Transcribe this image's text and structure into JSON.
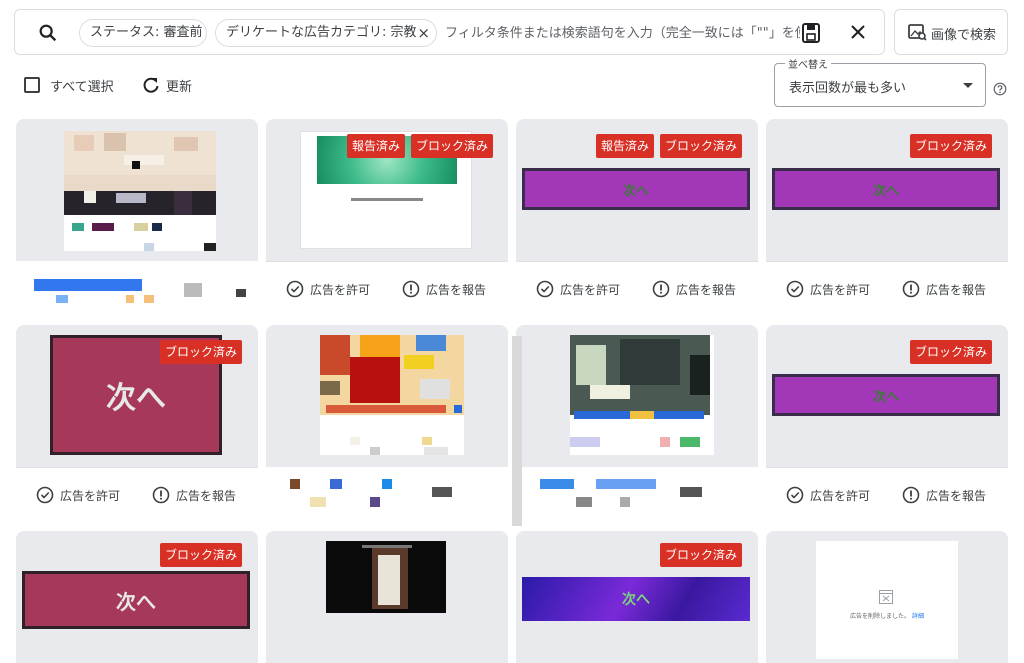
{
  "search": {
    "chips": [
      {
        "label": "ステータス: 審査前"
      },
      {
        "label": "デリケートな広告カテゴリ: 宗教",
        "close": "×"
      }
    ],
    "placeholder": "フィルタ条件または検索語句を入力（完全一致には「\"\"」を使",
    "clear": "×",
    "image_search_label": "画像で検索"
  },
  "toolbar": {
    "select_all": "すべて選択",
    "refresh": "更新",
    "sort_label": "並べ替え",
    "sort_value": "表示回数が最も多い"
  },
  "labels": {
    "allow": "広告を許可",
    "report": "広告を報告",
    "reported": "報告済み",
    "blocked": "ブロック済み",
    "next": "次へ",
    "ad_removed": "広告を削除しました。",
    "details": "詳細"
  },
  "cards": [
    {
      "id": 1,
      "badges": [],
      "actions": false
    },
    {
      "id": 2,
      "badges": [
        "reported",
        "blocked"
      ],
      "actions": true
    },
    {
      "id": 3,
      "badges": [
        "reported",
        "blocked"
      ],
      "actions": true
    },
    {
      "id": 4,
      "badges": [
        "blocked"
      ],
      "actions": true
    },
    {
      "id": 5,
      "badges": [
        "blocked"
      ],
      "actions": true
    },
    {
      "id": 6,
      "badges": [],
      "actions": false
    },
    {
      "id": 7,
      "badges": [],
      "actions": false
    },
    {
      "id": 8,
      "badges": [
        "blocked"
      ],
      "actions": true
    },
    {
      "id": 9,
      "badges": [
        "blocked"
      ],
      "actions": false
    },
    {
      "id": 10,
      "badges": [],
      "actions": false
    },
    {
      "id": 11,
      "badges": [
        "blocked"
      ],
      "actions": false
    },
    {
      "id": 12,
      "badges": [],
      "actions": false
    }
  ],
  "colors": {
    "badge": "#d93025",
    "purple_banner": "#a237b8",
    "maroon_banner": "#a6385a",
    "card_bg": "#e9eaee"
  }
}
